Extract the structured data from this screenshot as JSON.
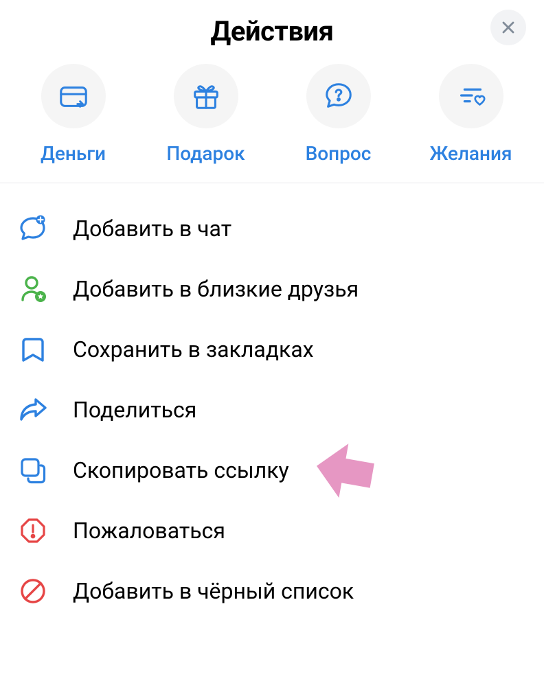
{
  "header": {
    "title": "Действия"
  },
  "quick_actions": [
    {
      "label": "Деньги",
      "icon": "money-send-icon"
    },
    {
      "label": "Подарок",
      "icon": "gift-icon"
    },
    {
      "label": "Вопрос",
      "icon": "question-icon"
    },
    {
      "label": "Желания",
      "icon": "wishlist-icon"
    }
  ],
  "menu": [
    {
      "label": "Добавить в чат",
      "icon": "add-to-chat-icon",
      "color": "#2d81e0"
    },
    {
      "label": "Добавить в близкие друзья",
      "icon": "close-friends-icon",
      "color": "#4bb34b"
    },
    {
      "label": "Сохранить в закладках",
      "icon": "bookmark-icon",
      "color": "#2d81e0"
    },
    {
      "label": "Поделиться",
      "icon": "share-icon",
      "color": "#2d81e0"
    },
    {
      "label": "Скопировать ссылку",
      "icon": "copy-link-icon",
      "color": "#2d81e0"
    },
    {
      "label": "Пожаловаться",
      "icon": "report-icon",
      "color": "#e64646"
    },
    {
      "label": "Добавить в чёрный список",
      "icon": "block-icon",
      "color": "#e64646"
    }
  ]
}
